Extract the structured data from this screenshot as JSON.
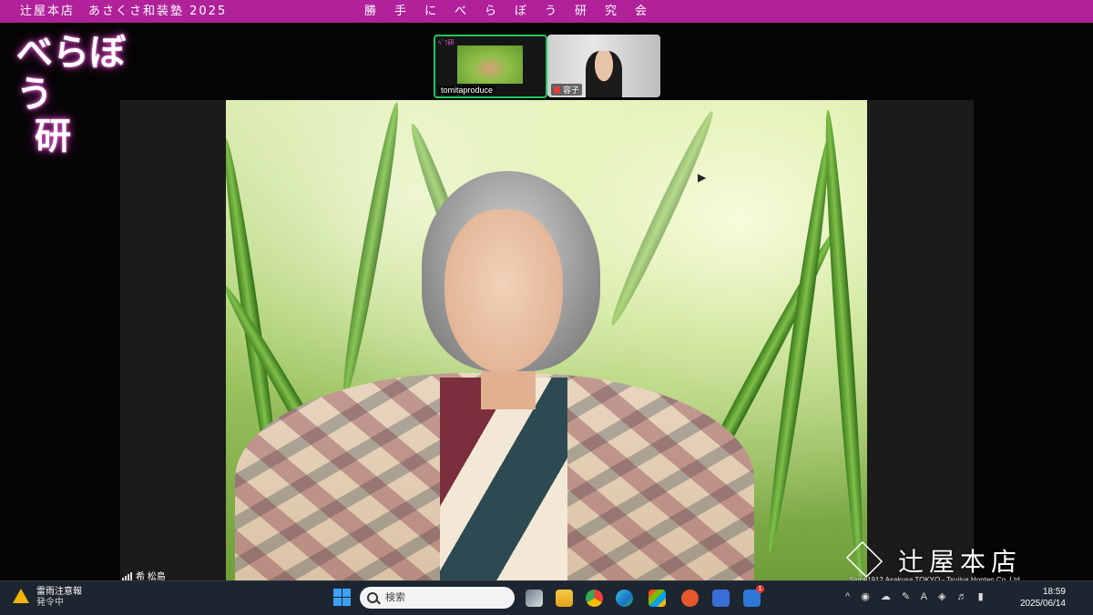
{
  "header": {
    "left_title": "辻屋本店　あさくさ和装塾 2025",
    "center_title": "勝手にべらぼう研究会"
  },
  "logo": {
    "line1": "べらぼう",
    "line2": "研"
  },
  "gallery": {
    "thumbnails": [
      {
        "name": "tomitaproduce",
        "tag": "ﾍﾞﾗ研",
        "active": true
      },
      {
        "name": "容子",
        "muted": true
      }
    ]
  },
  "main_video": {
    "participant_name": "希 松島",
    "signal_icon": "signal-bars-icon"
  },
  "watermark": {
    "brand_text": "辻屋本店",
    "subtitle": "Since1912 Asakusa TOKYO - Tsujiya Honten Co.,Ltd."
  },
  "taskbar": {
    "weather_title": "雷雨注意報",
    "weather_status": "発令中",
    "search_placeholder": "検索",
    "apps": [
      "task-view",
      "file-explorer",
      "chrome",
      "edge",
      "store",
      "app-orange",
      "app-settings",
      "app-calendar"
    ],
    "notification_count": "1",
    "time": "18:59",
    "date": "2025/06/14",
    "tray_items": [
      "^",
      "A"
    ]
  },
  "colors": {
    "header_bg": "#b0219a",
    "active_border": "#22c55e",
    "taskbar_bg": "#1d2530"
  }
}
